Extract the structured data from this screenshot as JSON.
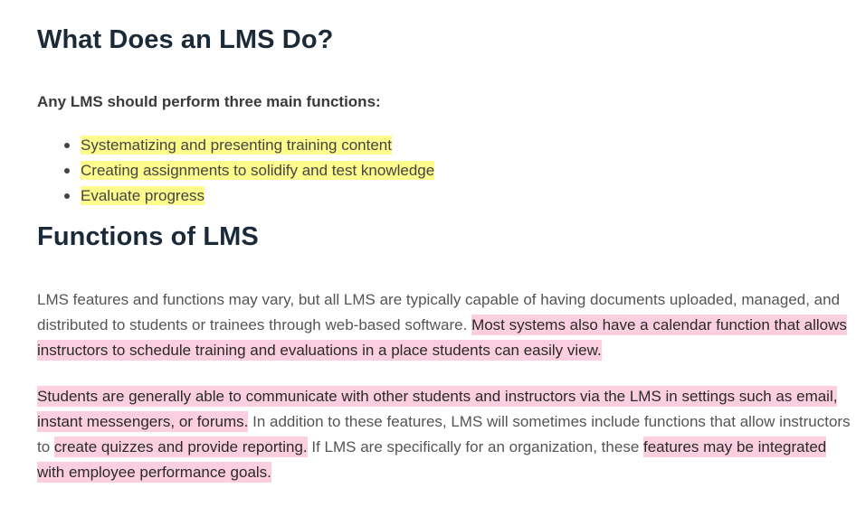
{
  "section_1": {
    "heading": "What Does an LMS Do?",
    "intro": "Any LMS should perform three main functions:",
    "functions": [
      "Systematizing and presenting training content",
      "Creating assignments to solidify and test knowledge",
      "Evaluate progress"
    ],
    "highlight_color": "#fdfc8c"
  },
  "section_2": {
    "heading": "Functions of LMS",
    "paragraph_1": {
      "text_1": "LMS features and functions may vary, but all LMS are typically capable of having documents uploaded, managed, and distributed to students or trainees through web-based software. ",
      "highlight_1": "Most systems also have a calendar function that allows instructors to schedule training and evaluations in a place students can easily view."
    },
    "paragraph_2": {
      "highlight_1": "Students are generally able to communicate with other students and instructors via the LMS in settings such as email, instant messengers, or forums.",
      "text_1": " In addition to these features, LMS will sometimes include functions that allow instructors to ",
      "highlight_2": "create quizzes and provide reporting.",
      "text_2": " If LMS are specifically for an organization, these ",
      "highlight_3": "features may be integrated with employee performance goals."
    },
    "highlight_color": "#fbcfdf"
  }
}
